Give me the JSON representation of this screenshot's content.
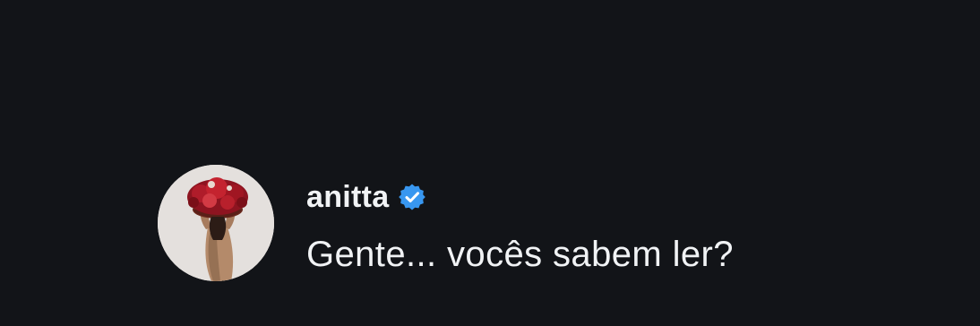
{
  "comment": {
    "username": "anitta",
    "verified_icon": "verified-badge-icon",
    "text": "Gente... vocês sabem ler?",
    "avatar_icon": "profile-avatar"
  },
  "colors": {
    "background": "#121418",
    "text": "#f1f3f5",
    "verified_blue": "#3897f0"
  }
}
